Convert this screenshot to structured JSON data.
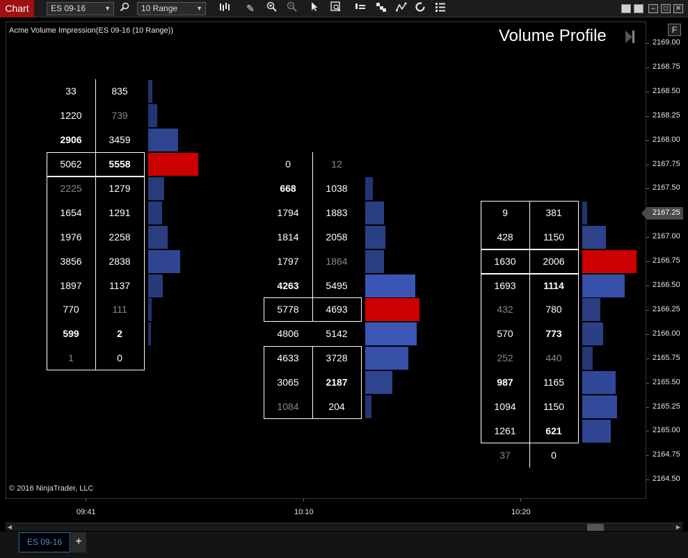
{
  "toolbar": {
    "chart_tab_label": "Chart",
    "instrument": "ES 09-16",
    "bar_type": "10 Range",
    "icons": [
      "search-icon",
      "bar-style-icon",
      "pencil-icon",
      "zoom-in-icon",
      "zoom-out-icon",
      "pointer-icon",
      "data-box-icon",
      "bars-icon",
      "hash-icon",
      "trend-icon",
      "reload-icon",
      "properties-icon"
    ]
  },
  "chart": {
    "label": "Acme Volume Impression(ES 09-16 (10 Range))",
    "volume_profile_title": "Volume Profile",
    "copyright": "© 2016 NinjaTrader, LLC",
    "f_button": "F",
    "current_price": "2167.25",
    "price_ticks": [
      "2169.00",
      "2168.75",
      "2168.50",
      "2168.25",
      "2168.00",
      "2167.75",
      "2167.50",
      "2167.25",
      "2167.00",
      "2166.75",
      "2166.50",
      "2166.25",
      "2166.00",
      "2165.75",
      "2165.50",
      "2165.25",
      "2165.00",
      "2164.75",
      "2164.50"
    ],
    "time_ticks": [
      "09:41",
      "10:10",
      "10:20"
    ],
    "colors": {
      "bar_blue": "#2e4490",
      "bar_red": "#cc0000",
      "background": "#000000"
    }
  },
  "bars": [
    {
      "rows": [
        {
          "bid": "33",
          "ask": "835",
          "vol": 0.07
        },
        {
          "bid": "1220",
          "ask": "739",
          "vol": 0.14
        },
        {
          "bid": "2906",
          "ask": "3459",
          "vol": 0.48
        },
        {
          "bid": "5062",
          "ask": "5558",
          "vol": 0.8,
          "poc": true
        },
        {
          "bid": "2225",
          "ask": "1279",
          "vol": 0.25
        },
        {
          "bid": "1654",
          "ask": "1291",
          "vol": 0.22
        },
        {
          "bid": "1976",
          "ask": "2258",
          "vol": 0.31
        },
        {
          "bid": "3856",
          "ask": "2838",
          "vol": 0.51
        },
        {
          "bid": "1897",
          "ask": "1137",
          "vol": 0.23
        },
        {
          "bid": "770",
          "ask": "111",
          "vol": 0.06
        },
        {
          "bid": "599",
          "ask": "2",
          "vol": 0.04
        },
        {
          "bid": "1",
          "ask": "0",
          "vol": 0
        }
      ]
    },
    {
      "rows": [
        {
          "bid": "0",
          "ask": "12",
          "vol": 0
        },
        {
          "bid": "668",
          "ask": "1038",
          "vol": 0.14
        },
        {
          "bid": "1794",
          "ask": "1883",
          "vol": 0.33
        },
        {
          "bid": "1814",
          "ask": "2058",
          "vol": 0.35
        },
        {
          "bid": "1797",
          "ask": "1864",
          "vol": 0.33
        },
        {
          "bid": "4263",
          "ask": "5495",
          "vol": 0.88
        },
        {
          "bid": "5778",
          "ask": "4693",
          "vol": 0.95,
          "poc": true
        },
        {
          "bid": "4806",
          "ask": "5142",
          "vol": 0.9
        },
        {
          "bid": "4633",
          "ask": "3728",
          "vol": 0.75
        },
        {
          "bid": "3065",
          "ask": "2187",
          "vol": 0.48
        },
        {
          "bid": "1084",
          "ask": "204",
          "vol": 0.11
        }
      ]
    },
    {
      "rows": [
        {
          "bid": "9",
          "ask": "381",
          "vol": 0.09
        },
        {
          "bid": "428",
          "ask": "1150",
          "vol": 0.42
        },
        {
          "bid": "1630",
          "ask": "2006",
          "vol": 0.95,
          "poc": true
        },
        {
          "bid": "1693",
          "ask": "1114",
          "vol": 0.74
        },
        {
          "bid": "432",
          "ask": "780",
          "vol": 0.32
        },
        {
          "bid": "570",
          "ask": "773",
          "vol": 0.36
        },
        {
          "bid": "252",
          "ask": "440",
          "vol": 0.18
        },
        {
          "bid": "987",
          "ask": "1165",
          "vol": 0.58
        },
        {
          "bid": "1094",
          "ask": "1150",
          "vol": 0.61
        },
        {
          "bid": "1261",
          "ask": "621",
          "vol": 0.5
        },
        {
          "bid": "37",
          "ask": "0",
          "vol": 0
        }
      ]
    }
  ]
}
